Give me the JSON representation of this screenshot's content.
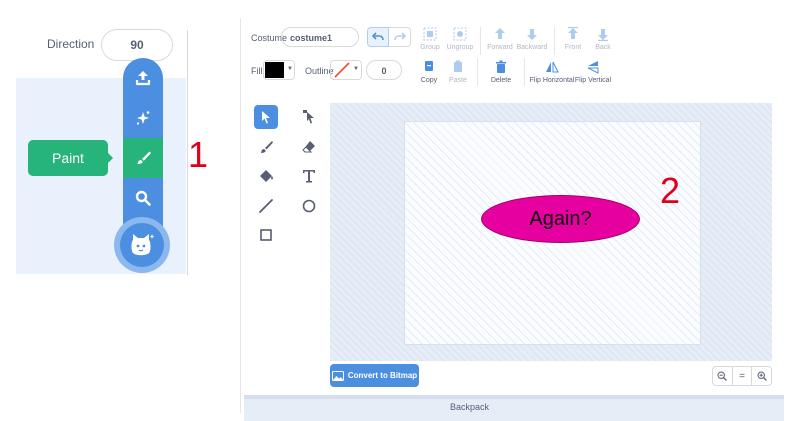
{
  "sprite_panel": {
    "direction_label": "Direction",
    "direction_value": "90",
    "menu_items": [
      "upload-icon",
      "surprise-icon",
      "paint-brush-icon",
      "search-icon"
    ],
    "paint_tooltip": "Paint",
    "choose_sprite_icon": "cat-icon"
  },
  "annotations": {
    "step1": "1",
    "step2": "2"
  },
  "editor": {
    "costume_label": "Costume",
    "costume_name": "costume1",
    "toolbar": {
      "group": "Group",
      "ungroup": "Ungroup",
      "forward": "Forward",
      "backward": "Backward",
      "front": "Front",
      "back": "Back",
      "copy": "Copy",
      "paste": "Paste",
      "delete": "Delete",
      "flip_horizontal": "Flip Horizontal",
      "flip_vertical": "Flip Vertical"
    },
    "fill_label": "Fill",
    "fill_color": "#000000",
    "outline_label": "Outline",
    "outline_width": "0",
    "convert_button": "Convert to Bitmap",
    "zoom": {
      "out": "−",
      "reset": "=",
      "in": "+"
    },
    "backpack_label": "Backpack"
  },
  "canvas": {
    "shape_text": "Again?",
    "shape_color": "#e6009f"
  },
  "colors": {
    "accent": "#4c8fe0",
    "paint_green": "#26b47b",
    "annotation_red": "#e0001a"
  }
}
